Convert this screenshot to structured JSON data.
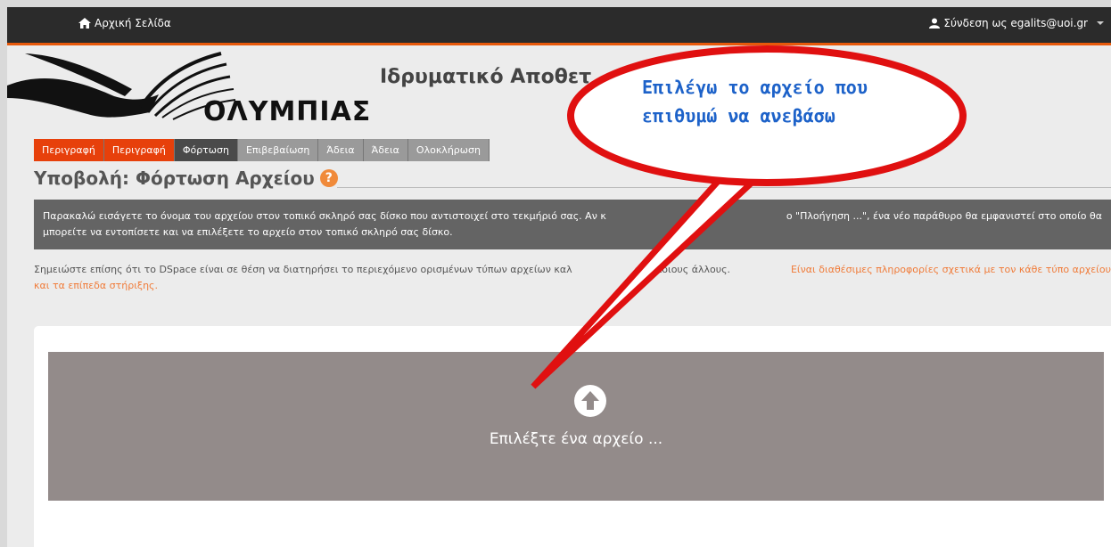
{
  "nav": {
    "home_label": "Αρχική Σελίδα",
    "login_label": "Σύνδεση ως egalits@uoi.gr"
  },
  "branding": {
    "logo_text": "ΟΛΥΜΠΙΑΣ",
    "repository_title": "Ιδρυματικό Αποθετ"
  },
  "steps": [
    {
      "label": "Περιγραφή",
      "state": "done"
    },
    {
      "label": "Περιγραφή",
      "state": "done"
    },
    {
      "label": "Φόρτωση",
      "state": "active"
    },
    {
      "label": "Επιβεβαίωση",
      "state": "todo"
    },
    {
      "label": "Άδεια",
      "state": "todo"
    },
    {
      "label": "Άδεια",
      "state": "todo"
    },
    {
      "label": "Ολοκλήρωση",
      "state": "todo"
    }
  ],
  "page": {
    "title": "Υποβολή: Φόρτωση Αρχείου",
    "help_symbol": "?",
    "info_line1": "Παρακαλώ εισάγετε το όνομα του αρχείου στον τοπικό σκληρό σας δίσκο που αντιστοιχεί στο τεκμήριό σας. Αν κ",
    "info_line1_end": "ο \"Πλοήγηση ...\", ένα νέο παράθυρο θα εμφανιστεί στο οποίο θα",
    "info_line2": "μπορείτε να εντοπίσετε και να επιλέξετε το αρχείο στον τοπικό σκληρό σας δίσκο.",
    "note_text": "Σημειώστε επίσης ότι το DSpace είναι σε θέση να διατηρήσει το περιεχόμενο ορισμένων τύπων αρχείων καλ",
    "note_text_end": "ο κάποιους άλλους.",
    "note_link": "Είναι διαθέσιμες πληροφορίες σχετικά με τον κάθε τύπο αρχείου",
    "note_link2": "και τα επίπεδα στήριξης."
  },
  "upload": {
    "label": "Επιλέξτε ένα αρχείο ..."
  },
  "callout": {
    "line1": "Επιλέγω το αρχείο που",
    "line2": "επιθυμώ να ανεβάσω"
  },
  "colors": {
    "accent": "#e7400b",
    "callout_border": "#e01010",
    "callout_text": "#1d62c9",
    "dropzone": "#938b8a"
  },
  "icons": [
    "home-icon",
    "user-icon",
    "caret-down-icon",
    "help-icon",
    "upload-arrow-icon"
  ]
}
